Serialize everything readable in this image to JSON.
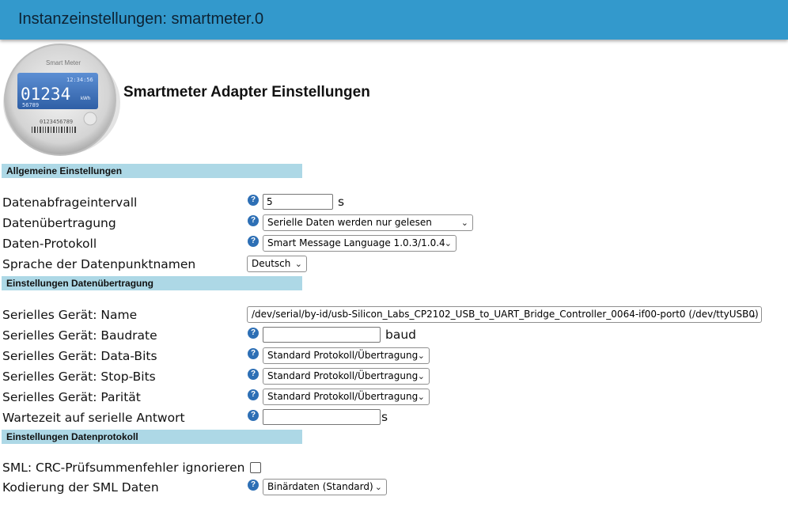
{
  "window": {
    "title": "Instanzeinstellungen: smartmeter.0"
  },
  "logo": {
    "brand": "Smart Meter",
    "time": "12:34:56",
    "value": "01234",
    "unit": "kWh",
    "sub": "56789",
    "serial": "0123456789"
  },
  "headline": "Smartmeter Adapter Einstellungen",
  "sections": {
    "general": "Allgemeine Einstellungen",
    "transfer": "Einstellungen Datenübertragung",
    "protocol": "Einstellungen Datenprotokoll"
  },
  "help_glyph": "?",
  "general": {
    "interval_label": "Datenabfrageintervall",
    "interval_value": "5",
    "interval_unit": "s",
    "transfer_label": "Datenübertragung",
    "transfer_value": "Serielle Daten werden nur gelesen",
    "protocol_label": "Daten-Protokoll",
    "protocol_value": "Smart Message Language 1.0.3/1.0.4",
    "language_label": "Sprache der Datenpunktnamen",
    "language_value": "Deutsch"
  },
  "serial": {
    "name_label": "Serielles Gerät: Name",
    "name_value": "/dev/serial/by-id/usb-Silicon_Labs_CP2102_USB_to_UART_Bridge_Controller_0064-if00-port0 (/dev/ttyUSB0)",
    "baud_label": "Serielles Gerät: Baudrate",
    "baud_value": "",
    "baud_unit": "baud",
    "databits_label": "Serielles Gerät: Data-Bits",
    "databits_value": "Standard Protokoll/Übertragung",
    "stopbits_label": "Serielles Gerät: Stop-Bits",
    "stopbits_value": "Standard Protokoll/Übertragung",
    "parity_label": "Serielles Gerät: Parität",
    "parity_value": "Standard Protokoll/Übertragung",
    "wait_label": "Wartezeit auf serielle Antwort",
    "wait_value": "",
    "wait_unit": "s"
  },
  "protocol": {
    "crc_label": "SML: CRC-Prüfsummenfehler ignorieren",
    "crc_checked": false,
    "encoding_label": "Kodierung der SML Daten",
    "encoding_value": "Binärdaten (Standard)"
  },
  "icons": {
    "help": "help-icon",
    "dropdown": "chevron-down-icon"
  }
}
